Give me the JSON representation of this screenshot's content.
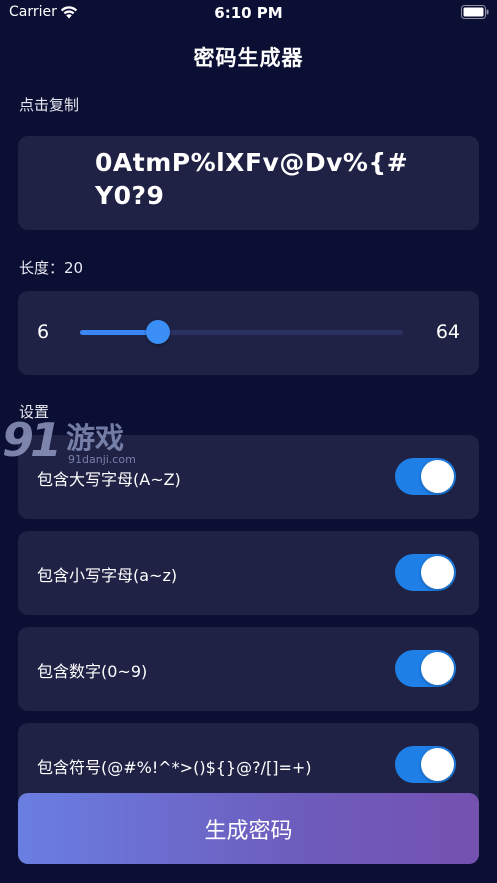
{
  "status_bar": {
    "carrier": "Carrier",
    "time": "6:10 PM"
  },
  "nav": {
    "title": "密码生成器"
  },
  "copy_section": {
    "label": "点击复制",
    "password": "0AtmP%lXFv@Dv%{#Y0?9"
  },
  "length_section": {
    "label": "长度：20",
    "value": 20,
    "min_label": "6",
    "max_label": "64",
    "min": 6,
    "max": 64
  },
  "settings": {
    "label": "设置",
    "items": [
      {
        "label": "包含大写字母(A~Z)",
        "on": true
      },
      {
        "label": "包含小写字母(a~z)",
        "on": true
      },
      {
        "label": "包含数字(0~9)",
        "on": true
      },
      {
        "label": "包含符号(@#%!^*>()${}@?/[]=+)",
        "on": true
      }
    ]
  },
  "generate_button": {
    "label": "生成密码"
  },
  "watermark": {
    "number": "91",
    "game": "游戏",
    "site": "91danji.com"
  },
  "colors": {
    "background": "#0b0f33",
    "card": "#1f2244",
    "accent": "#3a86f4",
    "toggle_on": "#1e7fe6",
    "button_gradient_start": "#6a7ee2",
    "button_gradient_end": "#7551b0"
  }
}
